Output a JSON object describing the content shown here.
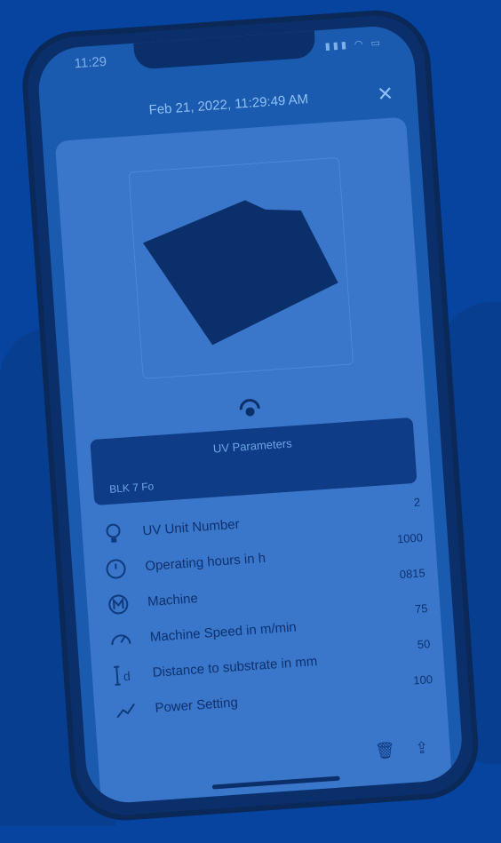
{
  "status": {
    "time": "11:29",
    "icons": "▮▮▮ ◠ ▭"
  },
  "header": {
    "title": "Feb 21, 2022, 11:29:49 AM",
    "close": "✕"
  },
  "panel": {
    "title": "UV Parameters",
    "subtitle": "BLK 7 Fo"
  },
  "parameters": [
    {
      "label": "UV Unit Number",
      "value": "2",
      "icon": "lightbulb-icon"
    },
    {
      "label": "Operating hours in h",
      "value": "1000",
      "icon": "clock-icon"
    },
    {
      "label": "Machine",
      "value": "0815",
      "icon": "machine-icon"
    },
    {
      "label": "Machine Speed in m/min",
      "value": "75",
      "icon": "speedometer-icon"
    },
    {
      "label": "Distance to substrate in mm",
      "value": "50",
      "icon": "distance-icon"
    },
    {
      "label": "Power Setting",
      "value": "100",
      "icon": "trend-line-icon"
    }
  ],
  "footer": {
    "delete": "🗑",
    "share": "⇪"
  },
  "colors": {
    "background": "#06449f",
    "sheet": "#3a76c9",
    "panel": "#0f3c86"
  }
}
